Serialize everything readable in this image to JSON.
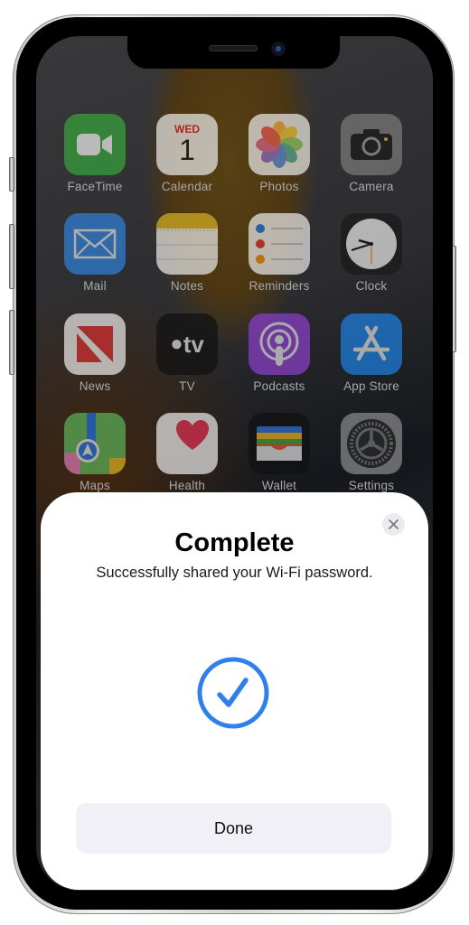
{
  "home_screen": {
    "apps": [
      {
        "id": "facetime",
        "label": "FaceTime",
        "icon": "facetime-icon"
      },
      {
        "id": "calendar",
        "label": "Calendar",
        "icon": "calendar-icon",
        "day": "WED",
        "date": "1"
      },
      {
        "id": "photos",
        "label": "Photos",
        "icon": "photos-icon"
      },
      {
        "id": "camera",
        "label": "Camera",
        "icon": "camera-icon"
      },
      {
        "id": "mail",
        "label": "Mail",
        "icon": "mail-icon"
      },
      {
        "id": "notes",
        "label": "Notes",
        "icon": "notes-icon"
      },
      {
        "id": "reminders",
        "label": "Reminders",
        "icon": "reminders-icon"
      },
      {
        "id": "clock",
        "label": "Clock",
        "icon": "clock-icon"
      },
      {
        "id": "news",
        "label": "News",
        "icon": "news-icon"
      },
      {
        "id": "tv",
        "label": "TV",
        "icon": "tv-icon",
        "glyph": "tv"
      },
      {
        "id": "podcasts",
        "label": "Podcasts",
        "icon": "podcasts-icon"
      },
      {
        "id": "appstore",
        "label": "App Store",
        "icon": "app-store-icon"
      },
      {
        "id": "maps",
        "label": "Maps",
        "icon": "maps-icon"
      },
      {
        "id": "health",
        "label": "Health",
        "icon": "health-icon"
      },
      {
        "id": "wallet",
        "label": "Wallet",
        "icon": "wallet-icon"
      },
      {
        "id": "settings",
        "label": "Settings",
        "icon": "settings-icon"
      }
    ]
  },
  "modal": {
    "title": "Complete",
    "subtitle": "Successfully shared your Wi-Fi password.",
    "status_icon": "checkmark-circle-icon",
    "close_icon": "close-icon",
    "done_label": "Done",
    "accent_color": "#2f80ed"
  }
}
